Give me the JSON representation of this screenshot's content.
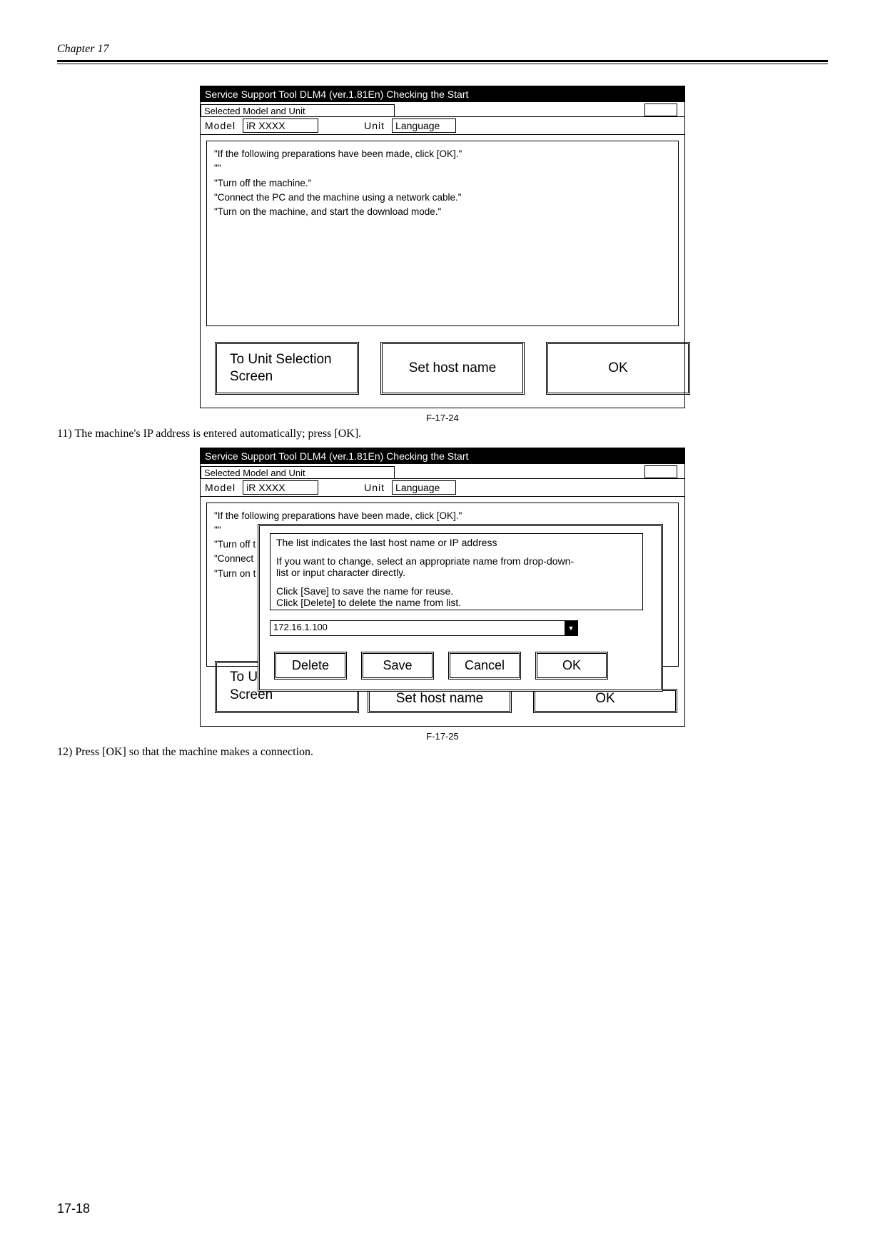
{
  "chapter": "Chapter 17",
  "fig1": {
    "titlebar": "Service Support Tool DLM4 (ver.1.81En) Checking the Start",
    "section_label": "Selected Model and Unit",
    "model_label": "Model",
    "model_value": "iR XXXX",
    "unit_label": "Unit",
    "unit_value": "Language",
    "content_line1": "\"If the following preparations have been made, click [OK].\"",
    "content_line2": "\"\"",
    "content_line3": "\"Turn off the machine.\"",
    "content_line4": "\"Connect the PC and the machine using a network cable.\"",
    "content_line5": "\"Turn on the machine, and start the download mode.\"",
    "btn_unit": "To Unit Selection\nScreen",
    "btn_sethost": "Set host name",
    "btn_ok": "OK",
    "caption": "F-17-24"
  },
  "step11": "11) The machine's IP address is entered automatically; press [OK].",
  "fig2": {
    "titlebar": "Service Support Tool DLM4 (ver.1.81En) Checking the Start",
    "section_label": "Selected Model and Unit",
    "model_label": "Model",
    "model_value": "iR XXXX",
    "unit_label": "Unit",
    "unit_value": "Language",
    "content_line1": "\"If the following preparations have been made, click [OK].\"",
    "content_line2": "\"\"",
    "bg_line3": "\"Turn off t",
    "bg_line4": "\"Connect",
    "bg_line5": "\"Turn on t",
    "dlg_line1": "The list indicates the last host name or IP address",
    "dlg_line2": "If you want to change, select an appropriate name from drop-down-list or input character directly.",
    "dlg_line3": "Click [Save] to save the name for reuse.",
    "dlg_line4": "Click [Delete] to delete the name from list.",
    "ip_value": "172.16.1.100",
    "btn_delete": "Delete",
    "btn_save": "Save",
    "btn_cancel": "Cancel",
    "btn_ok": "OK",
    "btn_unit_partial_top": "To U",
    "btn_unit_partial_bottom": "Screen",
    "btn_sethost_partial": "Set host name",
    "btn_ok_partial": "OK",
    "caption": "F-17-25"
  },
  "step12": "12) Press [OK] so that the machine makes a connection.",
  "footer": "17-18"
}
